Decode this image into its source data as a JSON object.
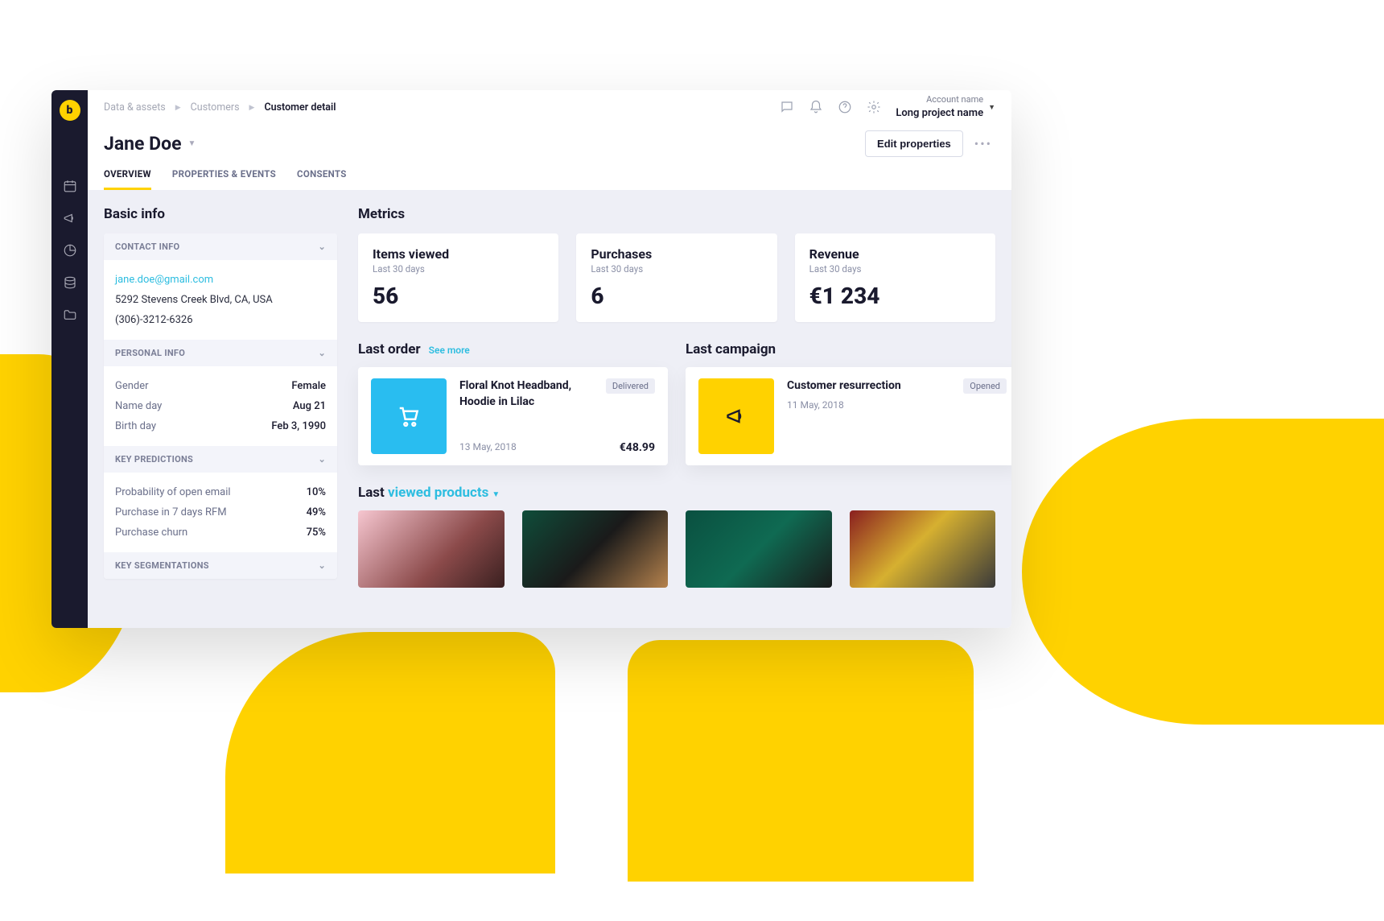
{
  "breadcrumbs": {
    "a": "Data & assets",
    "b": "Customers",
    "c": "Customer detail"
  },
  "account": {
    "name": "Account name",
    "project": "Long project name"
  },
  "customer_name": "Jane Doe",
  "edit_button": "Edit properties",
  "tabs": {
    "overview": "OVERVIEW",
    "props": "PROPERTIES & EVENTS",
    "consents": "CONSENTS"
  },
  "basic_info_title": "Basic info",
  "contact": {
    "header": "CONTACT INFO",
    "email": "jane.doe@gmail.com",
    "address": "5292 Stevens Creek Blvd, CA, USA",
    "phone": "(306)-3212-6326"
  },
  "personal": {
    "header": "PERSONAL INFO",
    "rows": [
      {
        "k": "Gender",
        "v": "Female"
      },
      {
        "k": "Name day",
        "v": "Aug 21"
      },
      {
        "k": "Birth day",
        "v": "Feb 3, 1990"
      }
    ]
  },
  "predictions": {
    "header": "KEY PREDICTIONS",
    "rows": [
      {
        "k": "Probability of open email",
        "v": "10%"
      },
      {
        "k": "Purchase in 7 days RFM",
        "v": "49%"
      },
      {
        "k": "Purchase churn",
        "v": "75%"
      }
    ]
  },
  "segmentations_header": "KEY SEGMENTATIONS",
  "metrics_title": "Metrics",
  "metrics": [
    {
      "title": "Items viewed",
      "sub": "Last 30 days",
      "val": "56"
    },
    {
      "title": "Purchases",
      "sub": "Last 30 days",
      "val": "6"
    },
    {
      "title": "Revenue",
      "sub": "Last 30 days",
      "val": "€1 234"
    }
  ],
  "last_order": {
    "title": "Last order",
    "see_more": "See more",
    "product": "Floral Knot Headband, Hoodie in Lilac",
    "status": "Delivered",
    "date": "13 May, 2018",
    "price": "€48.99"
  },
  "last_campaign": {
    "title": "Last campaign",
    "name": "Customer resurrection",
    "status": "Opened",
    "date": "11 May, 2018"
  },
  "last_viewed": {
    "prefix": "Last ",
    "link": "viewed products"
  }
}
